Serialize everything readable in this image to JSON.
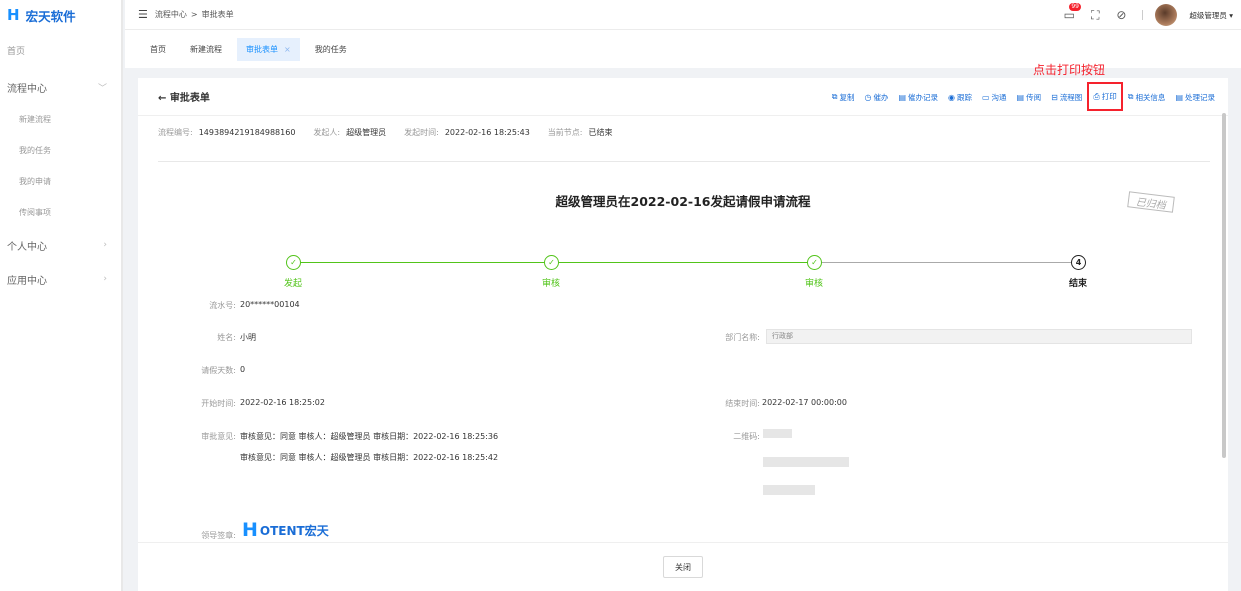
{
  "brand": {
    "mark": "H",
    "name": "宏天软件"
  },
  "sidebar": {
    "home": "首页",
    "process_center": "流程中心",
    "sub_items": [
      "新建流程",
      "我的任务",
      "我的申请",
      "传阅事项"
    ],
    "personal_center": "个人中心",
    "app_center": "应用中心"
  },
  "topbar": {
    "breadcrumb": [
      "流程中心",
      "审批表单"
    ],
    "breadcrumb_sep": ">",
    "notify_count": "99",
    "user_name": "超级管理员",
    "dropdown_arrow": "▾"
  },
  "tabs": [
    {
      "label": "首页",
      "active": false
    },
    {
      "label": "新建流程",
      "active": false
    },
    {
      "label": "审批表单",
      "active": true
    },
    {
      "label": "我的任务",
      "active": false
    }
  ],
  "tab_close": "×",
  "card": {
    "back_label": "← 审批表单",
    "toolbar": [
      {
        "icon": "copy-icon",
        "glyph": "⧉",
        "label": "复制"
      },
      {
        "icon": "alarm-icon",
        "glyph": "◷",
        "label": "催办"
      },
      {
        "icon": "record-icon",
        "glyph": "▤",
        "label": "催办记录"
      },
      {
        "icon": "track-icon",
        "glyph": "◉",
        "label": "跟踪"
      },
      {
        "icon": "chat-icon",
        "glyph": "▭",
        "label": "沟通"
      },
      {
        "icon": "forward-icon",
        "glyph": "▤",
        "label": "传阅"
      },
      {
        "icon": "flowchart-icon",
        "glyph": "⊟",
        "label": "流程图"
      },
      {
        "icon": "print-icon",
        "glyph": "⎙",
        "label": "打印"
      },
      {
        "icon": "info-icon",
        "glyph": "⧉",
        "label": "相关信息"
      },
      {
        "icon": "history-icon",
        "glyph": "▤",
        "label": "处理记录"
      }
    ],
    "callout": "点击打印按钮",
    "meta": {
      "process_no_label": "流程编号:",
      "process_no": "1493894219184988160",
      "initiator_label": "发起人:",
      "initiator": "超级管理员",
      "start_time_label": "发起时间:",
      "start_time": "2022-02-16 18:25:43",
      "node_label": "当前节点:",
      "node": "已结束"
    },
    "form_title": "超级管理员在2022-02-16发起请假申请流程",
    "stamp": "已归档",
    "steps": [
      {
        "label": "发起",
        "mark": "✓",
        "done": false
      },
      {
        "label": "审核",
        "mark": "✓",
        "done": false
      },
      {
        "label": "审核",
        "mark": "✓",
        "done": false
      },
      {
        "label": "结束",
        "mark": "4",
        "done": true
      }
    ],
    "fields": {
      "serial_label": "流水号:",
      "serial": "20******00104",
      "name_label": "姓名:",
      "name": "小明",
      "dept_label": "部门名称:",
      "dept": "行政部",
      "days_label": "请假天数:",
      "days": "0",
      "start_label": "开始时间:",
      "start": "2022-02-16 18:25:02",
      "end_label": "结束时间:",
      "end": "2022-02-17 00:00:00",
      "opinion_label": "审批意见:",
      "opinions": [
        "审核意见：同意 审核人：超级管理员 审核日期：2022-02-16 18:25:36",
        "审核意见：同意 审核人：超级管理员 审核日期：2022-02-16 18:25:42"
      ],
      "qrcode_label": "二维码:",
      "signature_label": "领导签章:",
      "signature_mark": "H",
      "signature_text": "OTENT宏天"
    },
    "close_button": "关闭"
  },
  "colors": {
    "accent": "#1890ff",
    "success": "#52c41a",
    "danger": "#f5222d"
  }
}
